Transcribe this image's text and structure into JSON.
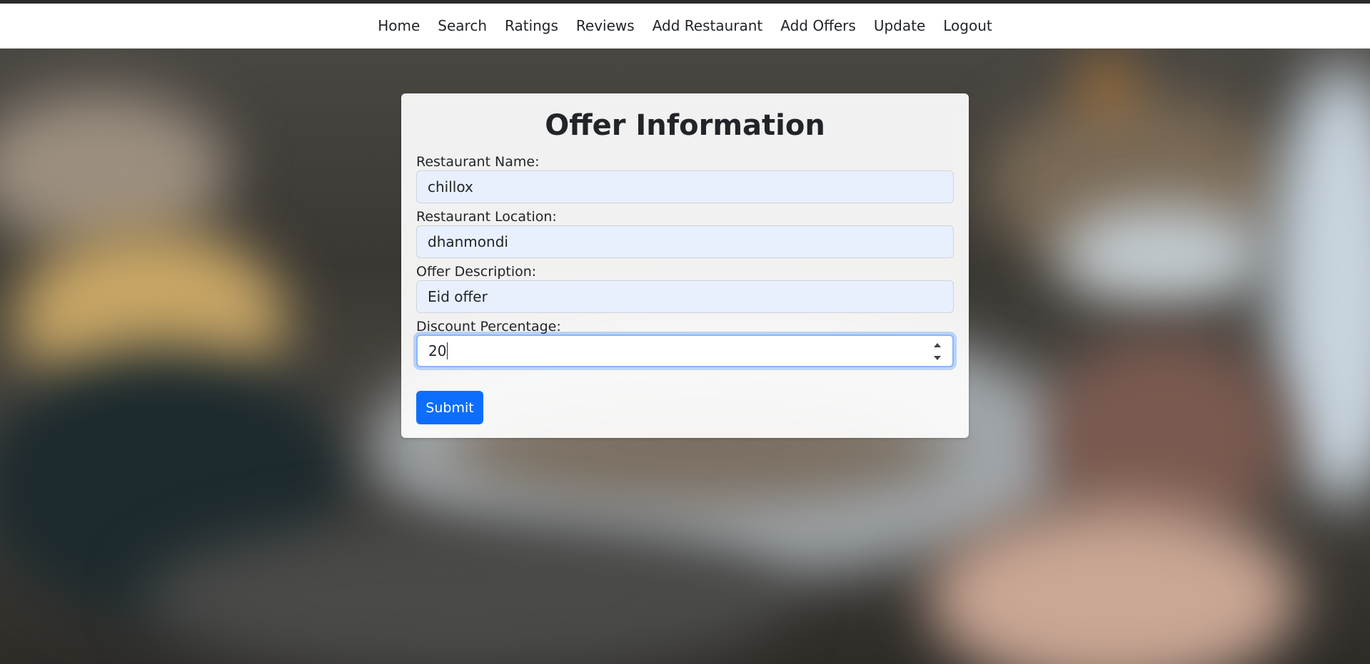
{
  "nav": {
    "items": [
      {
        "label": "Home"
      },
      {
        "label": "Search"
      },
      {
        "label": "Ratings"
      },
      {
        "label": "Reviews"
      },
      {
        "label": "Add Restaurant"
      },
      {
        "label": "Add Offers"
      },
      {
        "label": "Update"
      },
      {
        "label": "Logout"
      }
    ]
  },
  "form": {
    "title": "Offer Information",
    "fields": [
      {
        "label": "Restaurant Name:",
        "value": "chillox"
      },
      {
        "label": "Restaurant Location:",
        "value": "dhanmondi"
      },
      {
        "label": "Offer Description:",
        "value": "Eid offer"
      },
      {
        "label": "Discount Percentage:",
        "value": "20"
      }
    ],
    "submit_label": "Submit"
  },
  "colors": {
    "primary": "#0d6efd",
    "input_autofill_bg": "#e8f0fe",
    "focus_border": "#86b7fe"
  }
}
